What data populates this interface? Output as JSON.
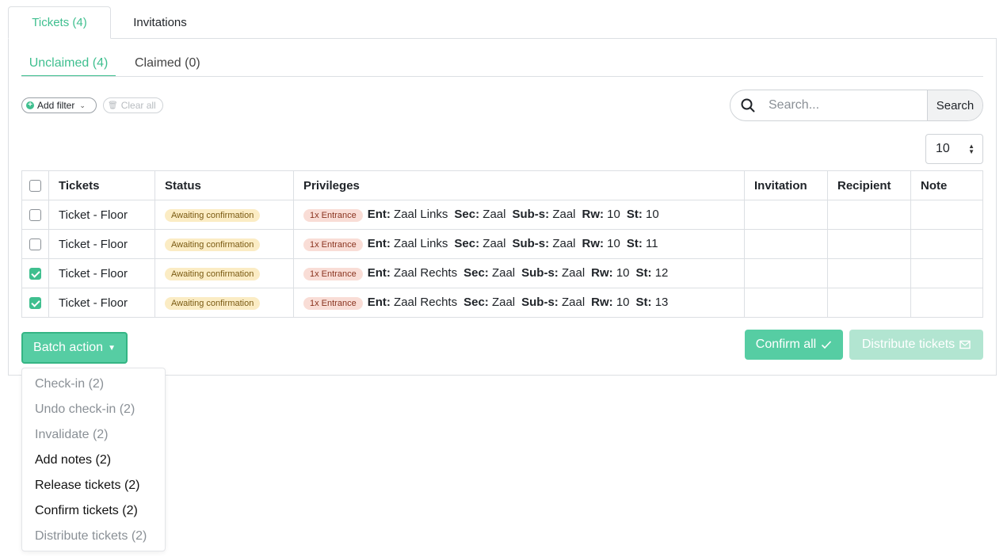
{
  "tabs": {
    "tickets": "Tickets (4)",
    "invitations": "Invitations"
  },
  "subtabs": {
    "unclaimed": "Unclaimed (4)",
    "claimed": "Claimed (0)"
  },
  "filters": {
    "add_filter": "Add filter",
    "clear_all": "Clear all"
  },
  "search": {
    "placeholder": "Search...",
    "button": "Search"
  },
  "page_size": "10",
  "table": {
    "headers": [
      "Tickets",
      "Status",
      "Privileges",
      "Invitation",
      "Recipient",
      "Note"
    ],
    "rows": [
      {
        "checked": false,
        "ticket": "Ticket - Floor",
        "status": "Awaiting confirmation",
        "priv_badge": "1x Entrance",
        "ent": "Zaal Links",
        "sec": "Zaal",
        "subs": "Zaal",
        "rw": "10",
        "st": "10"
      },
      {
        "checked": false,
        "ticket": "Ticket - Floor",
        "status": "Awaiting confirmation",
        "priv_badge": "1x Entrance",
        "ent": "Zaal Links",
        "sec": "Zaal",
        "subs": "Zaal",
        "rw": "10",
        "st": "11"
      },
      {
        "checked": true,
        "ticket": "Ticket - Floor",
        "status": "Awaiting confirmation",
        "priv_badge": "1x Entrance",
        "ent": "Zaal Rechts",
        "sec": "Zaal",
        "subs": "Zaal",
        "rw": "10",
        "st": "12"
      },
      {
        "checked": true,
        "ticket": "Ticket - Floor",
        "status": "Awaiting confirmation",
        "priv_badge": "1x Entrance",
        "ent": "Zaal Rechts",
        "sec": "Zaal",
        "subs": "Zaal",
        "rw": "10",
        "st": "13"
      }
    ],
    "priv_labels": {
      "ent": "Ent:",
      "sec": "Sec:",
      "subs": "Sub-s:",
      "rw": "Rw:",
      "st": "St:"
    }
  },
  "actions": {
    "batch": "Batch action",
    "confirm_all": "Confirm all",
    "distribute": "Distribute tickets"
  },
  "batch_menu": [
    {
      "label": "Check-in (2)",
      "enabled": false
    },
    {
      "label": "Undo check-in (2)",
      "enabled": false
    },
    {
      "label": "Invalidate (2)",
      "enabled": false
    },
    {
      "label": "Add notes (2)",
      "enabled": true
    },
    {
      "label": "Release tickets (2)",
      "enabled": true
    },
    {
      "label": "Confirm tickets (2)",
      "enabled": true
    },
    {
      "label": "Distribute tickets (2)",
      "enabled": false
    }
  ],
  "colors": {
    "accent": "#3fbf8f",
    "status_badge_bg": "#fbecc4",
    "priv_badge_bg": "#f9ddd6"
  }
}
